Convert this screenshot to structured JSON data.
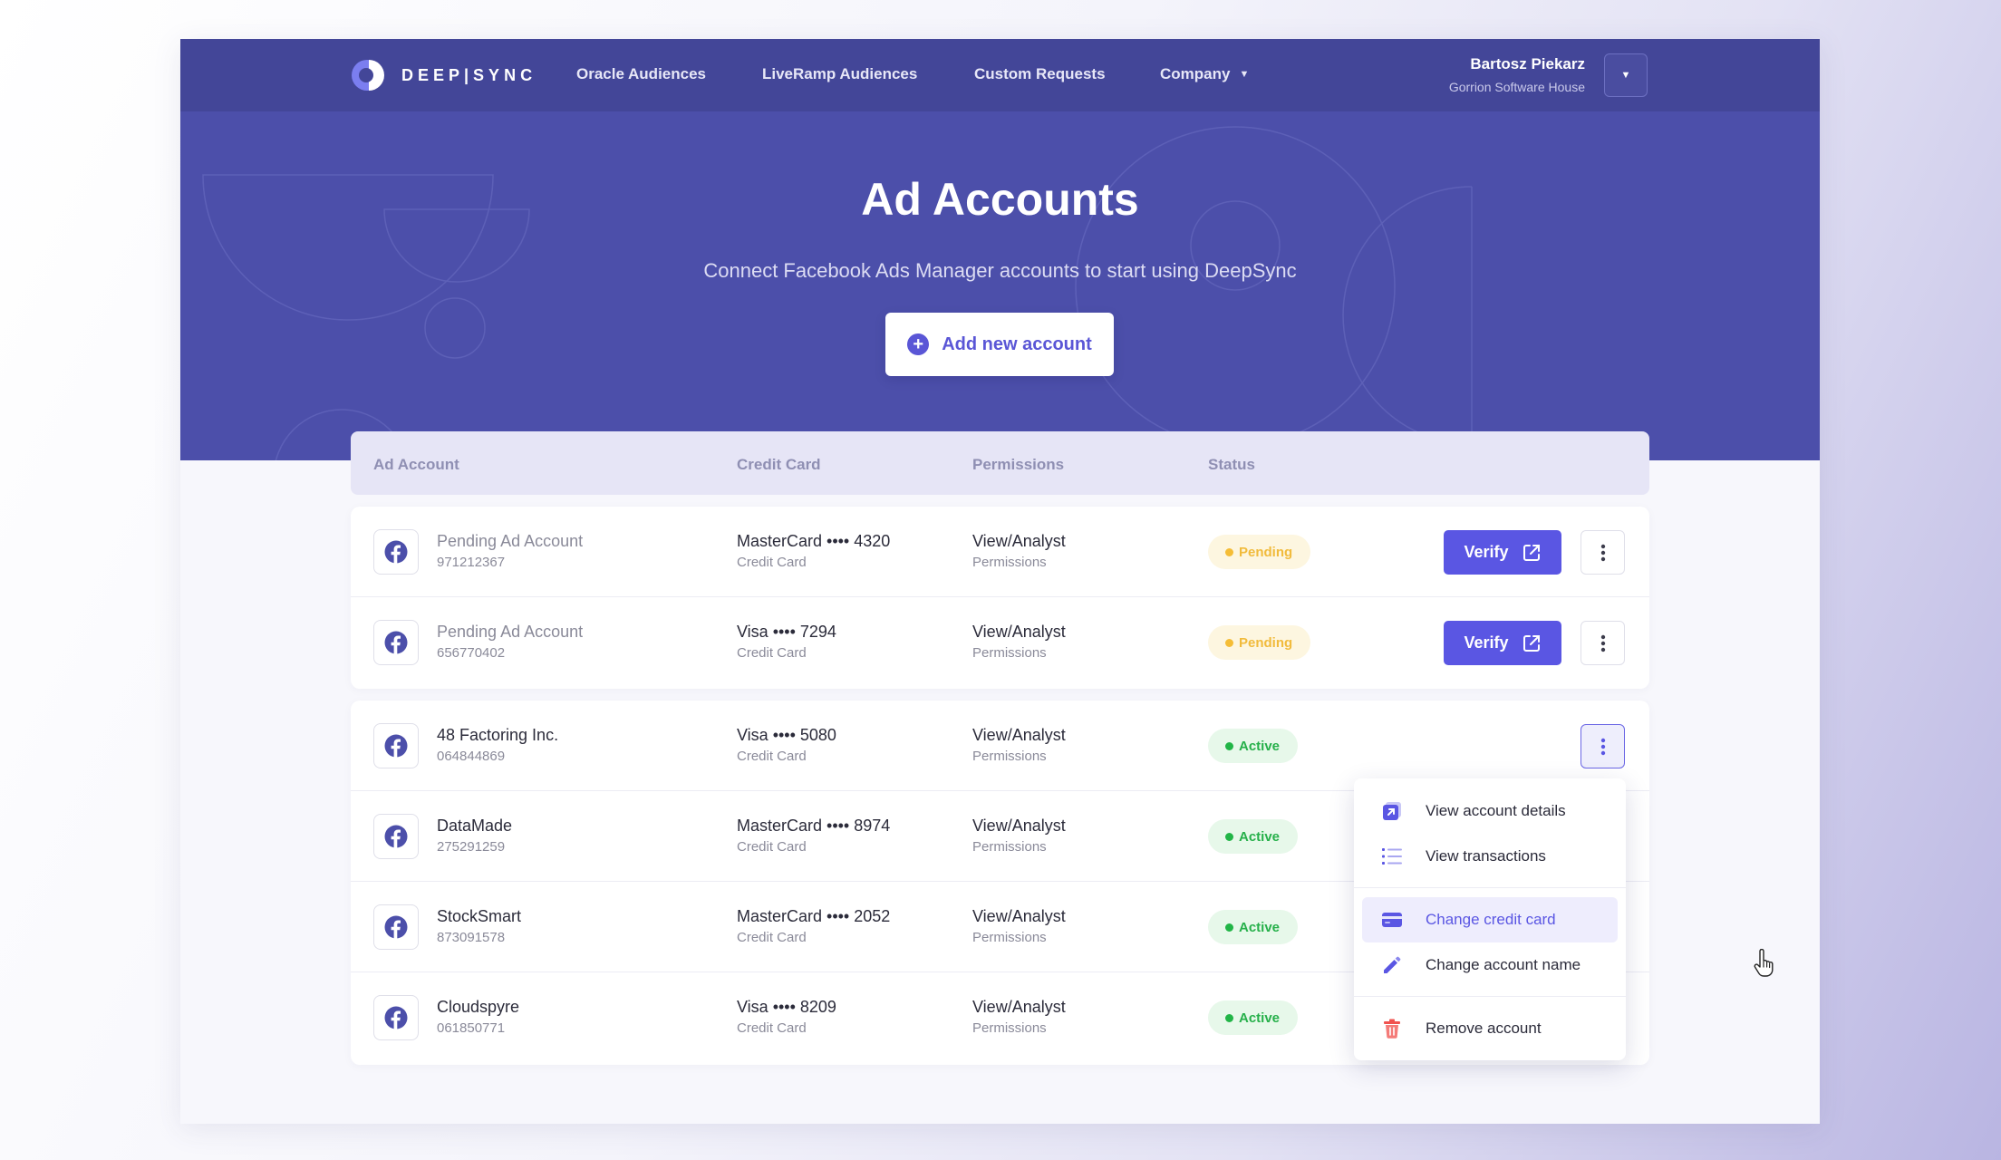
{
  "nav": {
    "logo_text": "DEEP|SYNC",
    "links": [
      "Oracle Audiences",
      "LiveRamp Audiences",
      "Custom Requests",
      "Company"
    ],
    "user_name": "Bartosz Piekarz",
    "user_company": "Gorrion Software House"
  },
  "hero": {
    "title": "Ad Accounts",
    "subtitle": "Connect Facebook Ads Manager accounts to start using DeepSync",
    "add_button": "Add new account"
  },
  "table": {
    "headers": [
      "Ad Account",
      "Credit Card",
      "Permissions",
      "Status"
    ],
    "pending_rows": [
      {
        "name": "Pending Ad Account",
        "id": "971212367",
        "card": "MasterCard •••• 4320",
        "card_sub": "Credit Card",
        "perm": "View/Analyst",
        "perm_sub": "Permissions",
        "status": "Pending",
        "action": "Verify"
      },
      {
        "name": "Pending Ad Account",
        "id": "656770402",
        "card": "Visa •••• 7294",
        "card_sub": "Credit Card",
        "perm": "View/Analyst",
        "perm_sub": "Permissions",
        "status": "Pending",
        "action": "Verify"
      }
    ],
    "active_rows": [
      {
        "name": "48 Factoring Inc.",
        "id": "064844869",
        "card": "Visa •••• 5080",
        "card_sub": "Credit Card",
        "perm": "View/Analyst",
        "perm_sub": "Permissions",
        "status": "Active"
      },
      {
        "name": "DataMade",
        "id": "275291259",
        "card": "MasterCard •••• 8974",
        "card_sub": "Credit Card",
        "perm": "View/Analyst",
        "perm_sub": "Permissions",
        "status": "Active"
      },
      {
        "name": "StockSmart",
        "id": "873091578",
        "card": "MasterCard •••• 2052",
        "card_sub": "Credit Card",
        "perm": "View/Analyst",
        "perm_sub": "Permissions",
        "status": "Active"
      },
      {
        "name": "Cloudspyre",
        "id": "061850771",
        "card": "Visa •••• 8209",
        "card_sub": "Credit Card",
        "perm": "View/Analyst",
        "perm_sub": "Permissions",
        "status": "Active"
      }
    ]
  },
  "menu": {
    "items": [
      "View account details",
      "View transactions",
      "Change credit card",
      "Change account name",
      "Remove account"
    ],
    "icons": [
      "external-details-icon",
      "list-icon",
      "credit-card-icon",
      "pencil-icon",
      "trash-icon"
    ],
    "hovered": "Change credit card"
  },
  "colors": {
    "brand": "#4c4faa",
    "nav": "#434698",
    "accent": "#5a56e3",
    "pending": "#f5bd36",
    "active": "#22b547",
    "danger": "#f0524f"
  }
}
